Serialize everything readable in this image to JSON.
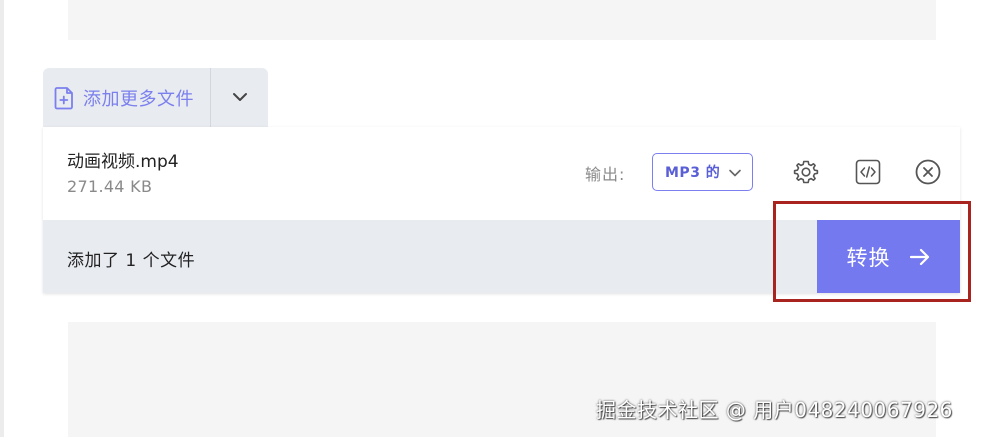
{
  "uploader": {
    "add_more_files_label": "添加更多文件",
    "add_icon": "file-plus-icon",
    "dropdown_icon": "chevron-down-icon"
  },
  "file": {
    "name": "动画视频.mp4",
    "size": "271.44 KB",
    "output_label": "输出:",
    "format_value": "MP3 的",
    "format_chevron_icon": "chevron-down-icon",
    "settings_icon": "gear-icon",
    "embed_icon": "code-icon",
    "remove_icon": "close-circle-icon"
  },
  "footer": {
    "files_added_text": "添加了 1 个文件",
    "convert_label": "转换",
    "convert_icon": "arrow-right-icon"
  },
  "watermark": "掘金技术社区 @ 用户048240067926",
  "colors": {
    "accent": "#7479f0",
    "accent_text": "#7b80ee",
    "panel_bg": "#e8ebf0",
    "highlight_box": "#a9231f"
  }
}
